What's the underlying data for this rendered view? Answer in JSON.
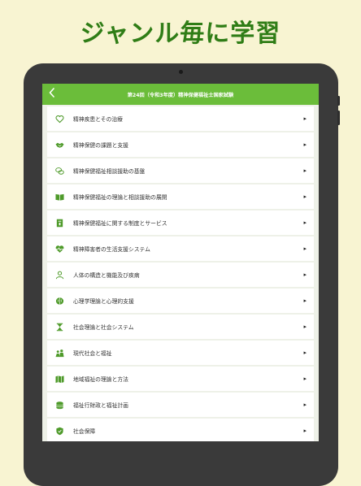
{
  "headline": "ジャンル毎に学習",
  "navbar": {
    "back_icon": "chevron-left-icon",
    "title": "第24回（令和3年度）精神保健福祉士国家試験"
  },
  "accent_color": "#6bbd3a",
  "icon_color": "#4e9a2a",
  "items": [
    {
      "label": "精神疾患とその治療",
      "icon": "heart-outline-icon"
    },
    {
      "label": "精神保健の課題と支援",
      "icon": "handshake-icon"
    },
    {
      "label": "精神保健福祉相談援助の基盤",
      "icon": "chat-bubbles-icon"
    },
    {
      "label": "精神保健福祉の理論と相談援助の展開",
      "icon": "open-book-icon"
    },
    {
      "label": "精神保健福祉に関する制度とサービス",
      "icon": "document-icon"
    },
    {
      "label": "精神障害者の生活支援システム",
      "icon": "heartbeat-icon"
    },
    {
      "label": "人体の構造と機能及び疾病",
      "icon": "person-icon"
    },
    {
      "label": "心理学理論と心理的支援",
      "icon": "brain-icon"
    },
    {
      "label": "社会理論と社会システム",
      "icon": "hourglass-icon"
    },
    {
      "label": "現代社会と福祉",
      "icon": "people-icon"
    },
    {
      "label": "地域福祉の理論と方法",
      "icon": "map-icon"
    },
    {
      "label": "福祉行財政と福祉計画",
      "icon": "coins-icon"
    },
    {
      "label": "社会保障",
      "icon": "shield-icon"
    }
  ]
}
